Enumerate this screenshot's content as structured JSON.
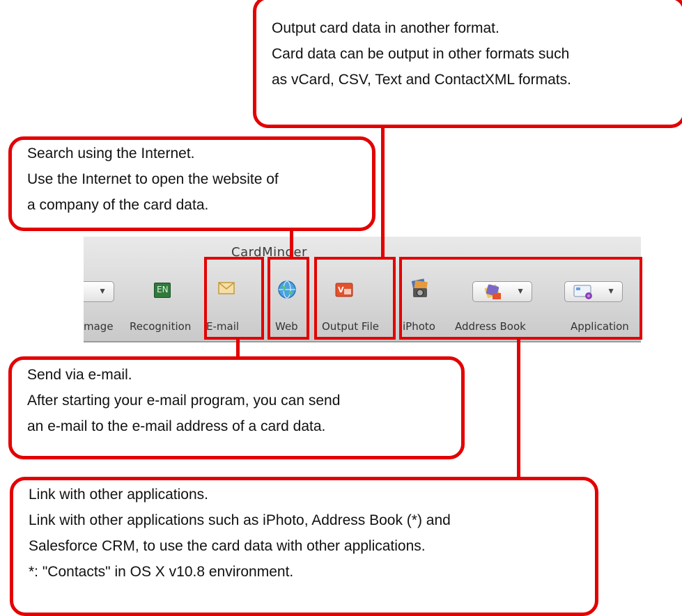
{
  "window": {
    "title": "CardMinder"
  },
  "toolbar": {
    "items": [
      {
        "label": "mage",
        "icon": "dropdown-icon"
      },
      {
        "label": "Recognition",
        "icon": "language-en-icon"
      },
      {
        "label": "E-mail",
        "icon": "envelope-icon"
      },
      {
        "label": "Web",
        "icon": "globe-icon"
      },
      {
        "label": "Output File",
        "icon": "vcard-file-icon"
      },
      {
        "label": "iPhoto",
        "icon": "iphoto-icon"
      },
      {
        "label": "Address Book",
        "icon": "address-book-icon"
      },
      {
        "label": "Application",
        "icon": "application-icon"
      }
    ],
    "en_badge": "EN"
  },
  "callouts": {
    "output": {
      "lines": [
        "Output card data in another format.",
        "Card data can be output in other formats such",
        "as vCard, CSV, Text and ContactXML formats."
      ]
    },
    "web": {
      "lines": [
        "Search using the Internet.",
        "Use the Internet to open the website of",
        "a company of the card data."
      ]
    },
    "email": {
      "lines": [
        "Send via e-mail.",
        "After starting your e-mail program, you can send",
        "an e-mail to the e-mail address of a card data."
      ]
    },
    "link": {
      "lines": [
        "Link with other applications.",
        "Link with other applications such as iPhoto, Address Book (*) and",
        "Salesforce CRM, to use the card data with other applications.",
        "*: \"Contacts\" in OS X v10.8 environment."
      ]
    }
  },
  "colors": {
    "accent": "#e30000",
    "toolbar_top": "#e9e9e9",
    "toolbar_bottom": "#c9c9c9"
  }
}
